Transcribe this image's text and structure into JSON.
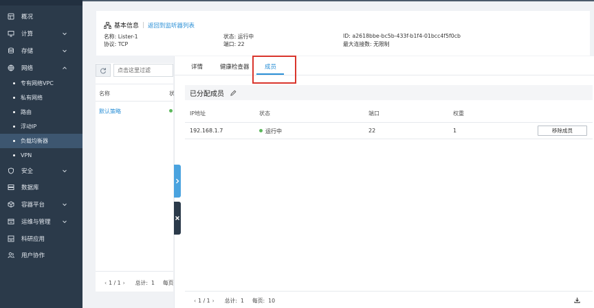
{
  "sidebar": {
    "items": [
      {
        "label": "概况",
        "icon": "dashboard-icon",
        "expandable": false
      },
      {
        "label": "计算",
        "icon": "monitor-icon",
        "expandable": true
      },
      {
        "label": "存储",
        "icon": "database-stack-icon",
        "expandable": true
      },
      {
        "label": "网络",
        "icon": "globe-icon",
        "expandable": true,
        "expanded": true
      },
      {
        "label": "安全",
        "icon": "shield-icon",
        "expandable": true
      },
      {
        "label": "数据库",
        "icon": "server-icon",
        "expandable": false
      },
      {
        "label": "容器平台",
        "icon": "container-icon",
        "expandable": true
      },
      {
        "label": "运维与管理",
        "icon": "ops-icon",
        "expandable": true
      },
      {
        "label": "科研应用",
        "icon": "research-icon",
        "expandable": false
      },
      {
        "label": "用户协作",
        "icon": "users-icon",
        "expandable": false
      }
    ],
    "network_sub": [
      {
        "label": "专有网络VPC"
      },
      {
        "label": "私有网络"
      },
      {
        "label": "路由"
      },
      {
        "label": "浮动IP"
      },
      {
        "label": "负载均衡器",
        "active": true
      },
      {
        "label": "VPN"
      }
    ]
  },
  "info": {
    "title": "基本信息",
    "back_link": "返回到监听器列表",
    "name": "名称: Lister-1",
    "protocol": "协议: TCP",
    "status": "状态: 运行中",
    "port": "端口: 22",
    "id": "ID: a2618bbe-bc5b-433f-b1f4-01bcc4f5f0cb",
    "max_conn": "最大连接数: 无限制"
  },
  "left_panel": {
    "filter_placeholder": "点击这里过滤",
    "col_name": "名称",
    "col_status": "状",
    "rows": [
      {
        "name": "默认策略",
        "status_color": "#5cb85c"
      }
    ],
    "pager": {
      "prev": "‹",
      "page": "1 / 1",
      "next": "›",
      "total_label": "总计:",
      "total": "1",
      "per_page_label": "每页"
    }
  },
  "tabs": [
    {
      "label": "详情"
    },
    {
      "label": "健康检查器"
    },
    {
      "label": "成员",
      "active": true
    }
  ],
  "members": {
    "section_title": "已分配成员",
    "columns": [
      "IP地址",
      "状态",
      "端口",
      "权重"
    ],
    "rows": [
      {
        "ip": "192.168.1.7",
        "status": "运行中",
        "port": "22",
        "weight": "1",
        "action": "移除成员"
      }
    ],
    "pager": {
      "prev": "‹",
      "page": "1 / 1",
      "next": "›",
      "total_label": "总计:",
      "total": "1",
      "per_page_label": "每页:",
      "per_page": "10"
    }
  },
  "colors": {
    "sidebar_bg": "#2b3a4a",
    "sidebar_active": "#3d5670",
    "accent": "#2a8fd6",
    "status_ok": "#5cb85c",
    "highlight": "#d9342b"
  }
}
